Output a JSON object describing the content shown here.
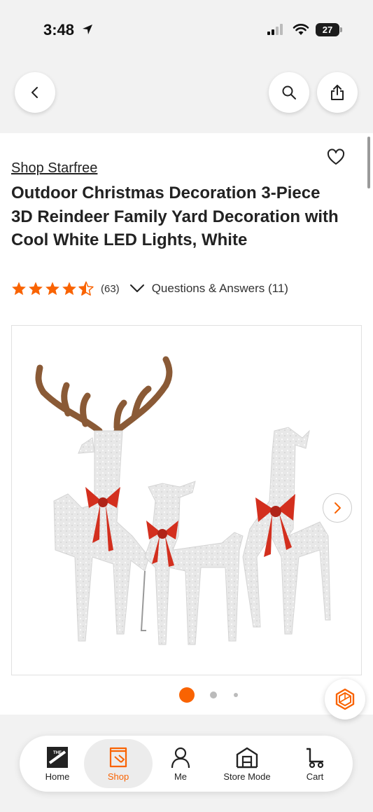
{
  "status_bar": {
    "time": "3:48",
    "battery": "27"
  },
  "header": {
    "back_icon": "chevron-left-icon",
    "search_icon": "search-icon",
    "share_icon": "share-icon"
  },
  "product": {
    "brand_link": "Shop Starfree",
    "title": "Outdoor Christmas Decoration 3-Piece 3D Reindeer Family Yard Decoration with Cool White LED Lights, White",
    "rating": 4.5,
    "review_count": "(63)",
    "qa_link": "Questions & Answers (11)"
  },
  "gallery": {
    "image_index": 1,
    "dot_count": 3
  },
  "tab_bar": {
    "items": [
      {
        "label": "Home",
        "icon": "home-depot-logo-icon"
      },
      {
        "label": "Shop",
        "icon": "shop-icon",
        "active": true
      },
      {
        "label": "Me",
        "icon": "person-icon"
      },
      {
        "label": "Store Mode",
        "icon": "store-icon"
      },
      {
        "label": "Cart",
        "icon": "cart-icon"
      }
    ]
  },
  "colors": {
    "accent": "#f96302",
    "star": "#f96302",
    "bow": "#d32f1e",
    "antler": "#8a5a36"
  }
}
